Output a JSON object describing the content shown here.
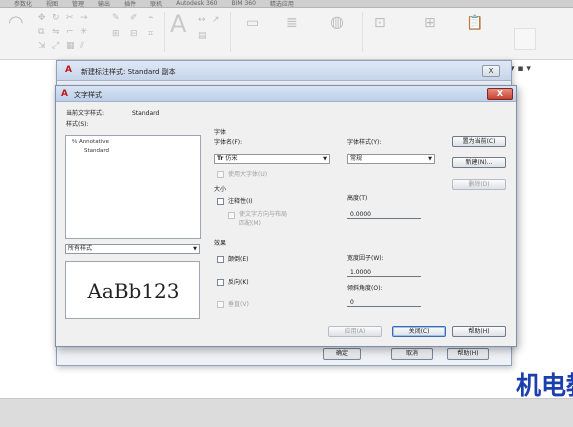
{
  "background": {
    "ribbon_tabs": [
      "参数化",
      "视图",
      "管理",
      "输出",
      "插件",
      "联机",
      "Autodesk 360",
      "BIM 360",
      "精选应用"
    ],
    "watermark": "机电教"
  },
  "outer_dialog": {
    "title": "新建标注样式: Standard 副本",
    "close_label": "X",
    "ok_label": "确定",
    "cancel_label": "取消",
    "help_label": "帮助(H)"
  },
  "dialog": {
    "title": "文字样式",
    "close_label": "X",
    "current_style_label": "当前文字样式:",
    "current_style_value": "Standard",
    "styles_label": "样式(S):",
    "styles": [
      "Annotative",
      "Standard"
    ],
    "filter_value": "所有样式",
    "preview_text": "AaBb123",
    "font_group_label": "字体",
    "font_name_label": "字体名(F):",
    "font_name_value": "仿宋",
    "font_style_label": "字体样式(Y):",
    "font_style_value": "常规",
    "use_big_font_label": "使用大字体(U)",
    "size_group_label": "大小",
    "annotative_label": "注释性(I)",
    "match_orientation_label": "使文字方向与布局",
    "match_orientation_label_2": "匹配(M)",
    "height_label": "高度(T)",
    "height_value": "0.0000",
    "effects_group_label": "效果",
    "upside_down_label": "颠倒(E)",
    "backwards_label": "反向(K)",
    "vertical_label": "垂直(V)",
    "width_factor_label": "宽度因子(W):",
    "width_factor_value": "1.0000",
    "oblique_angle_label": "倾斜角度(O):",
    "oblique_angle_value": "0",
    "set_current_label": "置为当前(C)",
    "new_label": "新建(N)...",
    "delete_label": "删除(D)",
    "apply_label": "应用(A)",
    "close_button_label": "关闭(C)",
    "help_label": "帮助(H)"
  }
}
